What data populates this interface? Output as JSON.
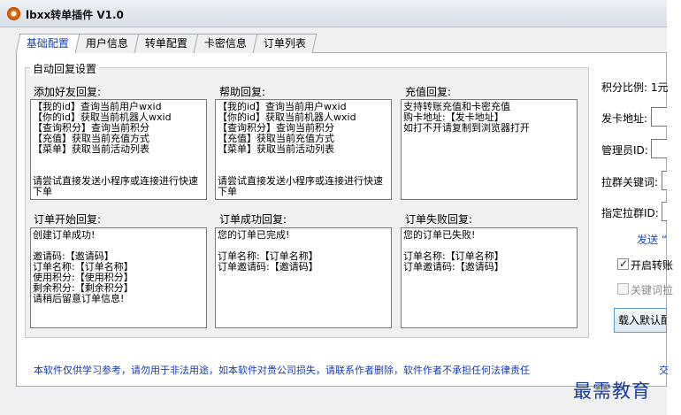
{
  "window": {
    "title": "lbxx转单插件 V1.0"
  },
  "tabs": [
    "基础配置",
    "用户信息",
    "转单配置",
    "卡密信息",
    "订单列表"
  ],
  "group_title": "自动回复设置",
  "replies": [
    {
      "label": "添加好友回复:",
      "text": "【我的id】查询当前用户wxid\n【你的id】获取当前机器人wxid\n【查询积分】查询当前积分\n【充值】获取当前充值方式\n【菜单】获取当前活动列表\n\n\n请尝试直接发送小程序或连接进行快速下单"
    },
    {
      "label": "帮助回复:",
      "text": "【我的id】查询当前用户wxid\n【你的id】获取当前机器人wxid\n【查询积分】查询当前积分\n【充值】获取当前充值方式\n【菜单】获取当前活动列表\n\n\n请尝试直接发送小程序或连接进行快速下单"
    },
    {
      "label": "充值回复:",
      "text": "支持转账充值和卡密充值\n购卡地址:【发卡地址】\n如打不开请复制到浏览器打开"
    },
    {
      "label": "订单开始回复:",
      "text": "创建订单成功!\n\n邀请码:【邀请码】\n订单名称:【订单名称】\n使用积分:【使用积分】\n剩余积分:【剩余积分】\n请稍后留意订单信息!"
    },
    {
      "label": "订单成功回复:",
      "text": "您的订单已完成!\n\n订单名称:【订单名称】\n订单邀请码:【邀请码】"
    },
    {
      "label": "订单失败回复:",
      "text": "您的订单已失败!\n\n订单名称:【订单名称】\n订单邀请码:【邀请码】"
    }
  ],
  "right_panel": {
    "ratio_label": "积分比例: 1元",
    "card_url_label": "发卡地址:",
    "admin_id_label": "管理员ID:",
    "pull_keyword_label": "拉群关键词:",
    "target_group_label": "指定拉群ID:",
    "send_link": "发送 “",
    "open_transfer_label": "开启转账",
    "keyword_label": "关键词拉",
    "load_default_button": "载入默认配"
  },
  "disclaimer": "本软件仅供学习参考，请勿用于非法用途，如本软件对贵公司损失，请联系作者删除，软件作者不承担任何法律责任",
  "disclaimer_extra": "交",
  "watermark": "最需教育"
}
